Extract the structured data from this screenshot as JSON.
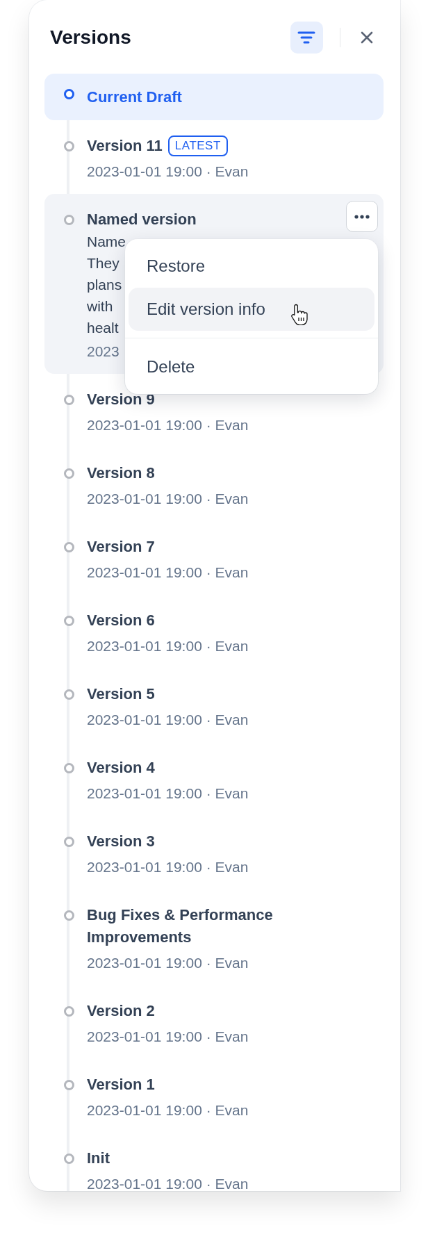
{
  "panel": {
    "title": "Versions",
    "filter_active": true
  },
  "versions": [
    {
      "kind": "draft",
      "title": "Current Draft",
      "selected": true
    },
    {
      "kind": "version",
      "title": "Version 11",
      "badge": "LATEST",
      "meta": "2023-01-01 19:00 · Evan",
      "selected": false
    },
    {
      "kind": "named",
      "title": "Named version",
      "description": [
        "Name",
        "They",
        "plans",
        "with",
        "healt"
      ],
      "meta": "2023",
      "hovered": true,
      "selected": false,
      "menu": [
        [
          {
            "label": "Restore",
            "selected": false
          },
          {
            "label": "Edit version info",
            "selected": true
          }
        ],
        [
          {
            "label": "Delete",
            "selected": false
          }
        ]
      ]
    },
    {
      "kind": "version",
      "title": "Version 9",
      "meta": "2023-01-01 19:00 · Evan",
      "selected": false
    },
    {
      "kind": "version",
      "title": "Version 8",
      "meta": "2023-01-01 19:00 · Evan",
      "selected": false
    },
    {
      "kind": "version",
      "title": "Version 7",
      "meta": "2023-01-01 19:00 · Evan",
      "selected": false
    },
    {
      "kind": "version",
      "title": "Version 6",
      "meta": "2023-01-01 19:00 · Evan",
      "selected": false
    },
    {
      "kind": "version",
      "title": "Version 5",
      "meta": "2023-01-01 19:00 · Evan",
      "selected": false
    },
    {
      "kind": "version",
      "title": "Version 4",
      "meta": "2023-01-01 19:00 · Evan",
      "selected": false
    },
    {
      "kind": "version",
      "title": "Version 3",
      "meta": "2023-01-01 19:00 · Evan",
      "selected": false
    },
    {
      "kind": "version",
      "title": "Bug Fixes & Performance Improvements",
      "meta": "2023-01-01 19:00 · Evan",
      "selected": false
    },
    {
      "kind": "version",
      "title": "Version 2",
      "meta": "2023-01-01 19:00 · Evan",
      "selected": false
    },
    {
      "kind": "version",
      "title": "Version 1",
      "meta": "2023-01-01 19:00 · Evan",
      "selected": false
    },
    {
      "kind": "version",
      "title": "Init",
      "meta": "2023-01-01 19:00 · Evan",
      "selected": false
    }
  ]
}
